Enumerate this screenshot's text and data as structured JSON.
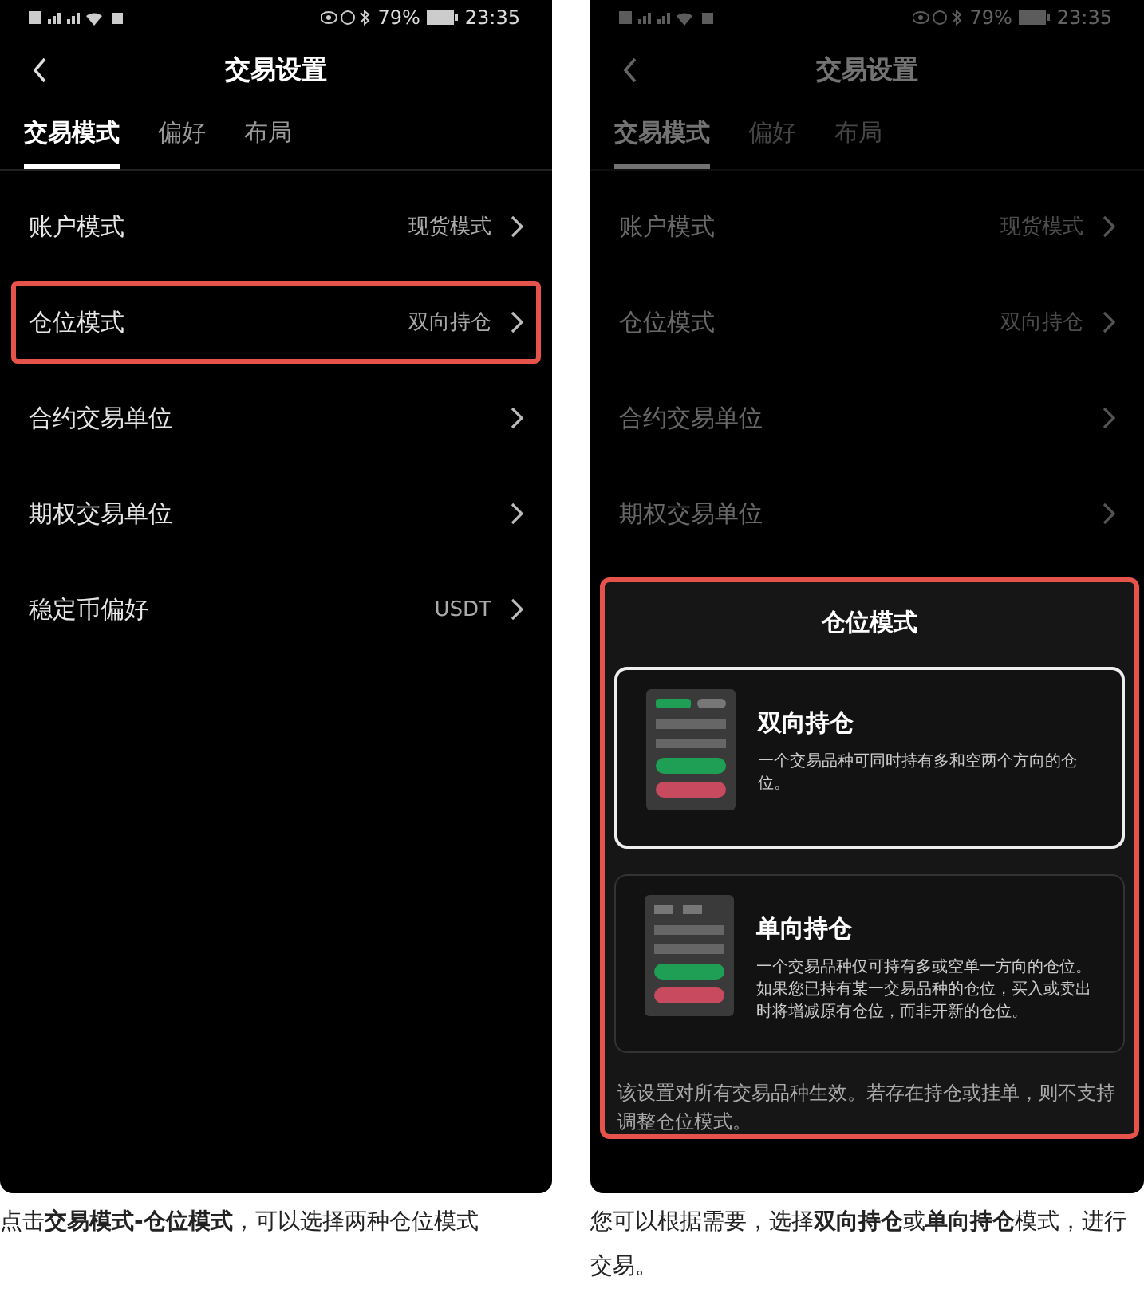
{
  "screens": [
    {
      "status_bar": {
        "battery": "79%",
        "time": "23:35"
      },
      "title": "交易设置",
      "dimmed": false,
      "tabs": [
        {
          "label": "交易模式",
          "selected": true
        },
        {
          "label": "偏好",
          "selected": false
        },
        {
          "label": "布局",
          "selected": false
        }
      ],
      "rows": [
        {
          "label": "账户模式",
          "value": "现货模式",
          "highlighted": false
        },
        {
          "label": "仓位模式",
          "value": "双向持仓",
          "highlighted": true
        },
        {
          "label": "合约交易单位",
          "highlighted": false
        },
        {
          "label": "期权交易单位",
          "highlighted": false
        },
        {
          "label": "稳定币偏好",
          "value": "USDT",
          "highlighted": false
        }
      ]
    },
    {
      "status_bar": {
        "battery": "79%",
        "time": "23:35"
      },
      "title": "交易设置",
      "dimmed": true,
      "tabs": [
        {
          "label": "交易模式",
          "selected": true
        },
        {
          "label": "偏好",
          "selected": false
        },
        {
          "label": "布局",
          "selected": false
        }
      ],
      "rows": [
        {
          "label": "账户模式",
          "value": "现货模式",
          "highlighted": false
        },
        {
          "label": "仓位模式",
          "value": "双向持仓",
          "highlighted": false
        },
        {
          "label": "合约交易单位",
          "highlighted": false
        },
        {
          "label": "期权交易单位",
          "highlighted": false
        }
      ],
      "sheet": {
        "title": "仓位模式",
        "highlighted": true,
        "options": [
          {
            "kind": "two-way",
            "title": "双向持仓",
            "description": "一个交易品种可同时持有多和空两个方向的仓位。",
            "selected": true
          },
          {
            "kind": "one-way",
            "title": "单向持仓",
            "description": "一个交易品种仅可持有多或空单一方向的仓位。如果您已持有某一交易品种的仓位，买入或卖出时将增减原有仓位，而非开新的仓位。",
            "selected": false
          }
        ],
        "note": "该设置对所有交易品种生效。若存在持仓或挂单，则不支持调整仓位模式。"
      }
    }
  ],
  "captions": [
    "点击**交易模式-仓位模式**，可以选择两种仓位模式",
    "您可以根据需要，选择**双向持仓**或**单向持仓**模式，进行交易。"
  ]
}
